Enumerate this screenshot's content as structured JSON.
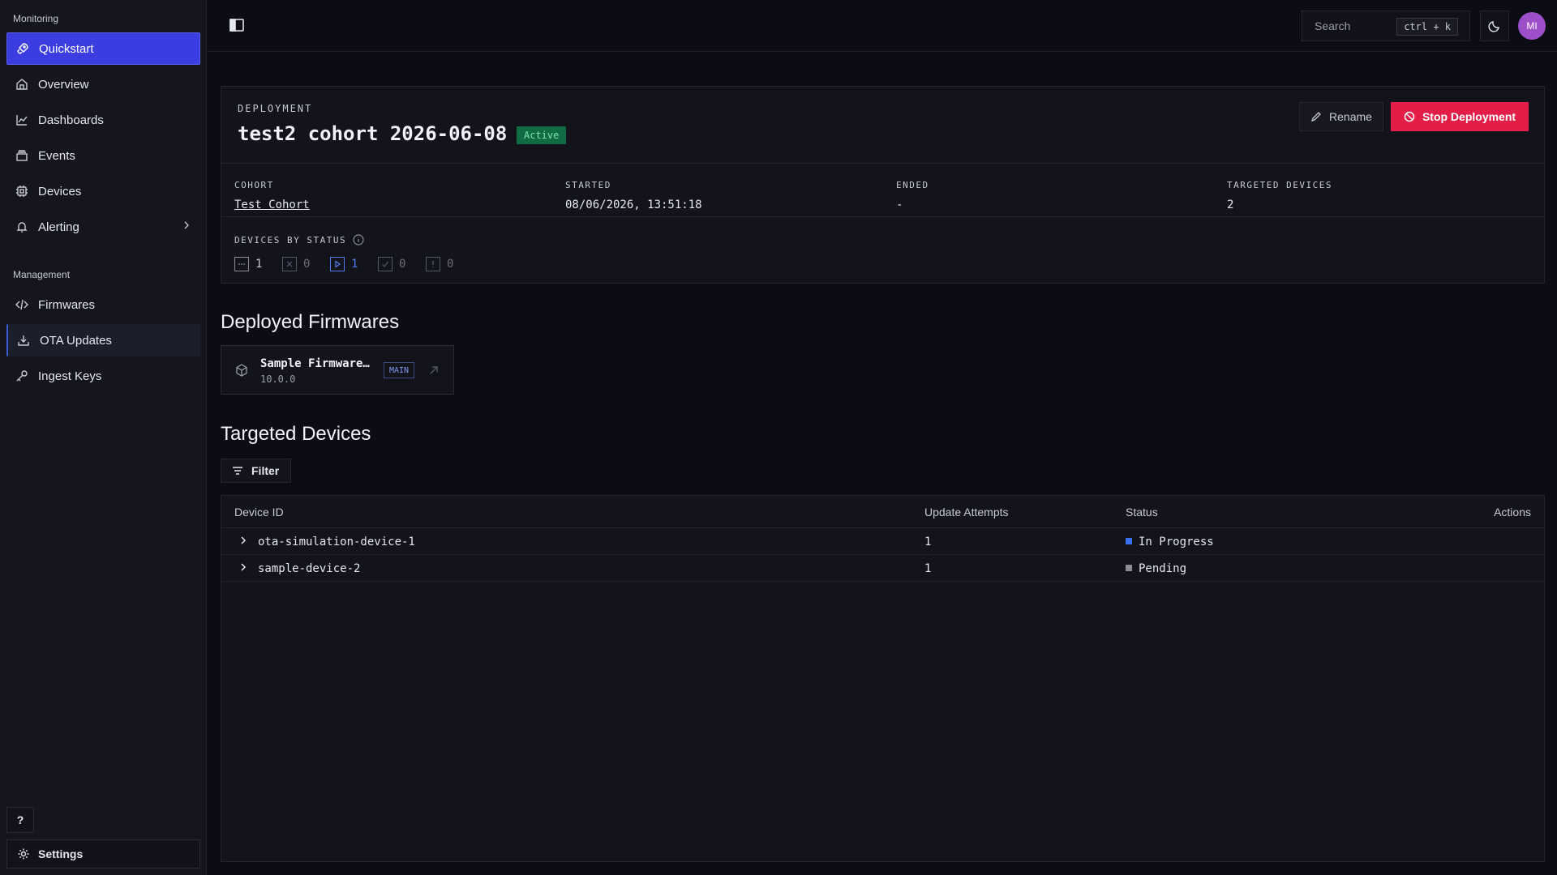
{
  "sidebar": {
    "monitoring_label": "Monitoring",
    "management_label": "Management",
    "items": [
      {
        "label": "Quickstart",
        "icon": "rocket-icon"
      },
      {
        "label": "Overview",
        "icon": "home-icon"
      },
      {
        "label": "Dashboards",
        "icon": "chart-line-icon"
      },
      {
        "label": "Events",
        "icon": "layers-icon"
      },
      {
        "label": "Devices",
        "icon": "chip-icon"
      },
      {
        "label": "Alerting",
        "icon": "bell-icon"
      },
      {
        "label": "Firmwares",
        "icon": "code-icon"
      },
      {
        "label": "OTA Updates",
        "icon": "download-icon"
      },
      {
        "label": "Ingest Keys",
        "icon": "key-icon"
      }
    ],
    "help_label": "?",
    "settings_label": "Settings"
  },
  "topbar": {
    "search_label": "Search",
    "search_shortcut": "ctrl + k",
    "avatar_initials": "MI"
  },
  "deployment": {
    "eyebrow": "DEPLOYMENT",
    "title": "test2 cohort 2026-06-08",
    "status_badge": "Active",
    "rename_label": "Rename",
    "stop_label": "Stop Deployment",
    "meta": {
      "cohort_label": "COHORT",
      "cohort_value": "Test Cohort",
      "started_label": "STARTED",
      "started_value": "08/06/2026, 13:51:18",
      "ended_label": "ENDED",
      "ended_value": "-",
      "targeted_label": "TARGETED DEVICES",
      "targeted_value": "2"
    },
    "devices_by_status_label": "DEVICES BY STATUS",
    "status_counts": [
      {
        "icon": "pending-icon",
        "count": "1"
      },
      {
        "icon": "failed-icon",
        "count": "0"
      },
      {
        "icon": "in-progress-icon",
        "count": "1"
      },
      {
        "icon": "completed-icon",
        "count": "0"
      },
      {
        "icon": "error-icon",
        "count": "0"
      }
    ]
  },
  "firmwares": {
    "heading": "Deployed Firmwares",
    "items": [
      {
        "name": "Sample Firmware…",
        "version": "10.0.0",
        "badge": "MAIN"
      }
    ]
  },
  "targeted": {
    "heading": "Targeted Devices",
    "filter_label": "Filter",
    "columns": [
      "Device ID",
      "Update Attempts",
      "Status",
      "Actions"
    ],
    "rows": [
      {
        "device_id": "ota-simulation-device-1",
        "attempts": "1",
        "status": "In Progress",
        "status_color": "#3b6ff0"
      },
      {
        "device_id": "sample-device-2",
        "attempts": "1",
        "status": "Pending",
        "status_color": "#8b8c98"
      }
    ]
  },
  "colors": {
    "accent": "#3b3de0",
    "danger": "#e11d48",
    "success_badge": "#0f6b42",
    "background": "#0c0d14"
  }
}
